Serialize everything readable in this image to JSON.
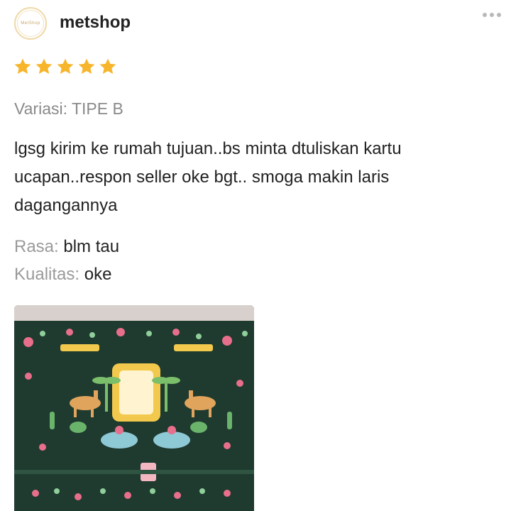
{
  "reviewer": {
    "username": "metshop",
    "avatar_text": "MetShop"
  },
  "rating": {
    "stars": 5,
    "max": 5,
    "color": "#f7b52c"
  },
  "variant": {
    "text": "Variasi: TIPE B"
  },
  "review": {
    "text": "lgsg kirim ke rumah tujuan..bs minta dtuliskan kartu ucapan..respon seller oke bgt.. smoga makin laris dagangannya"
  },
  "attributes": [
    {
      "key": "Rasa:",
      "value": "blm tau"
    },
    {
      "key": "Kualitas:",
      "value": "oke"
    }
  ],
  "more_icon": "more-horizontal-icon",
  "photo": {
    "subject": "product-photo",
    "colors": {
      "background": "#1f3a2f",
      "frame": "#f2c94c",
      "accent": "#e76f8c"
    }
  }
}
